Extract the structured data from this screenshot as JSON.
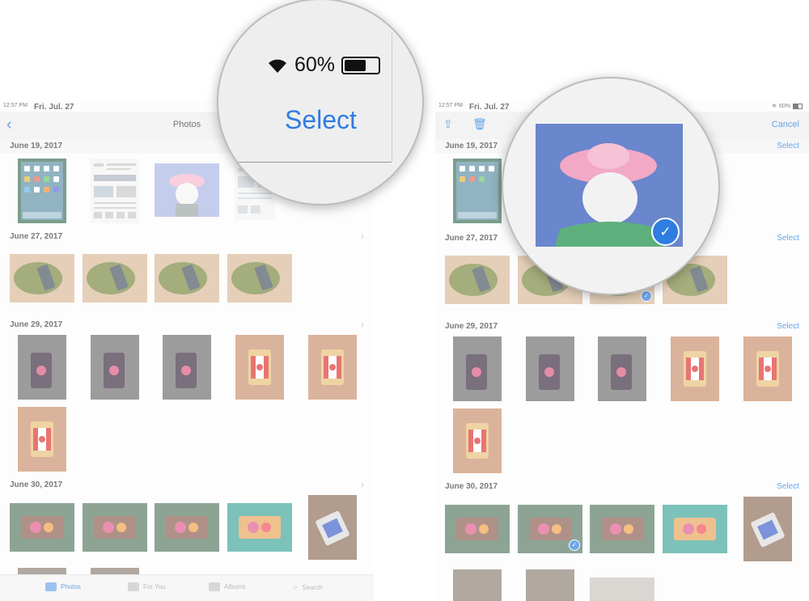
{
  "left": {
    "status": {
      "time": "12:57 PM",
      "date": "Fri. Jul. 27"
    },
    "nav": {
      "back": "‹",
      "title": "Photos"
    },
    "sections": [
      {
        "date": "June 19, 2017"
      },
      {
        "date": "June 27, 2017"
      },
      {
        "date": "June 29, 2017"
      },
      {
        "date": "June 30, 2017"
      }
    ],
    "tabs": [
      {
        "label": "Photos",
        "icon": "photos-icon"
      },
      {
        "label": "For You",
        "icon": "for-you-icon"
      },
      {
        "label": "Albums",
        "icon": "albums-icon"
      },
      {
        "label": "Search",
        "icon": "search-icon"
      }
    ]
  },
  "zoom_left": {
    "battery": "60%",
    "select_label": "Select"
  },
  "right": {
    "status": {
      "time": "12:57 PM",
      "date": "Fri. Jul. 27",
      "battery": "60%"
    },
    "nav": {
      "cancel": "Cancel",
      "share_icon": "share-icon",
      "trash_icon": "trash-icon"
    },
    "sections": [
      {
        "date": "June 19, 2017",
        "select": "Select"
      },
      {
        "date": "June 27, 2017",
        "select": "Select"
      },
      {
        "date": "June 29, 2017",
        "select": "Select"
      },
      {
        "date": "June 30, 2017",
        "select": "Select"
      }
    ]
  },
  "zoom_right": {
    "selected_photo": "cat in pink sun hat",
    "check": "✓"
  },
  "colors": {
    "accent": "#1f7ae0",
    "select_check": "#2f7de1"
  }
}
